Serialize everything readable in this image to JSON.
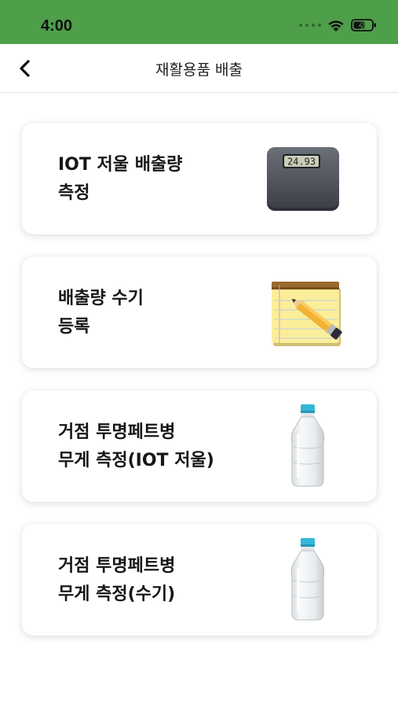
{
  "status_bar": {
    "time": "4:00",
    "icons": [
      "signal-dots-icon",
      "wifi-icon",
      "battery-charging-icon"
    ]
  },
  "header": {
    "title": "재활용품 배출",
    "back_icon": "chevron-left-icon"
  },
  "menu": [
    {
      "line1": "IOT 저울 배출량",
      "line2": "측정",
      "icon": "scale-icon"
    },
    {
      "line1": "배출량 수기",
      "line2": "등록",
      "icon": "notepad-pencil-icon"
    },
    {
      "line1": "거점 투명페트병",
      "line2": "무게 측정(IOT 저울)",
      "icon": "water-bottle-icon"
    },
    {
      "line1": "거점 투명페트병",
      "line2": "무게 측정(수기)",
      "icon": "water-bottle-icon"
    }
  ],
  "scale_display": "24.93",
  "colors": {
    "status_bar": "#4f9e4a",
    "bottle_cap": "#35b6d8"
  }
}
